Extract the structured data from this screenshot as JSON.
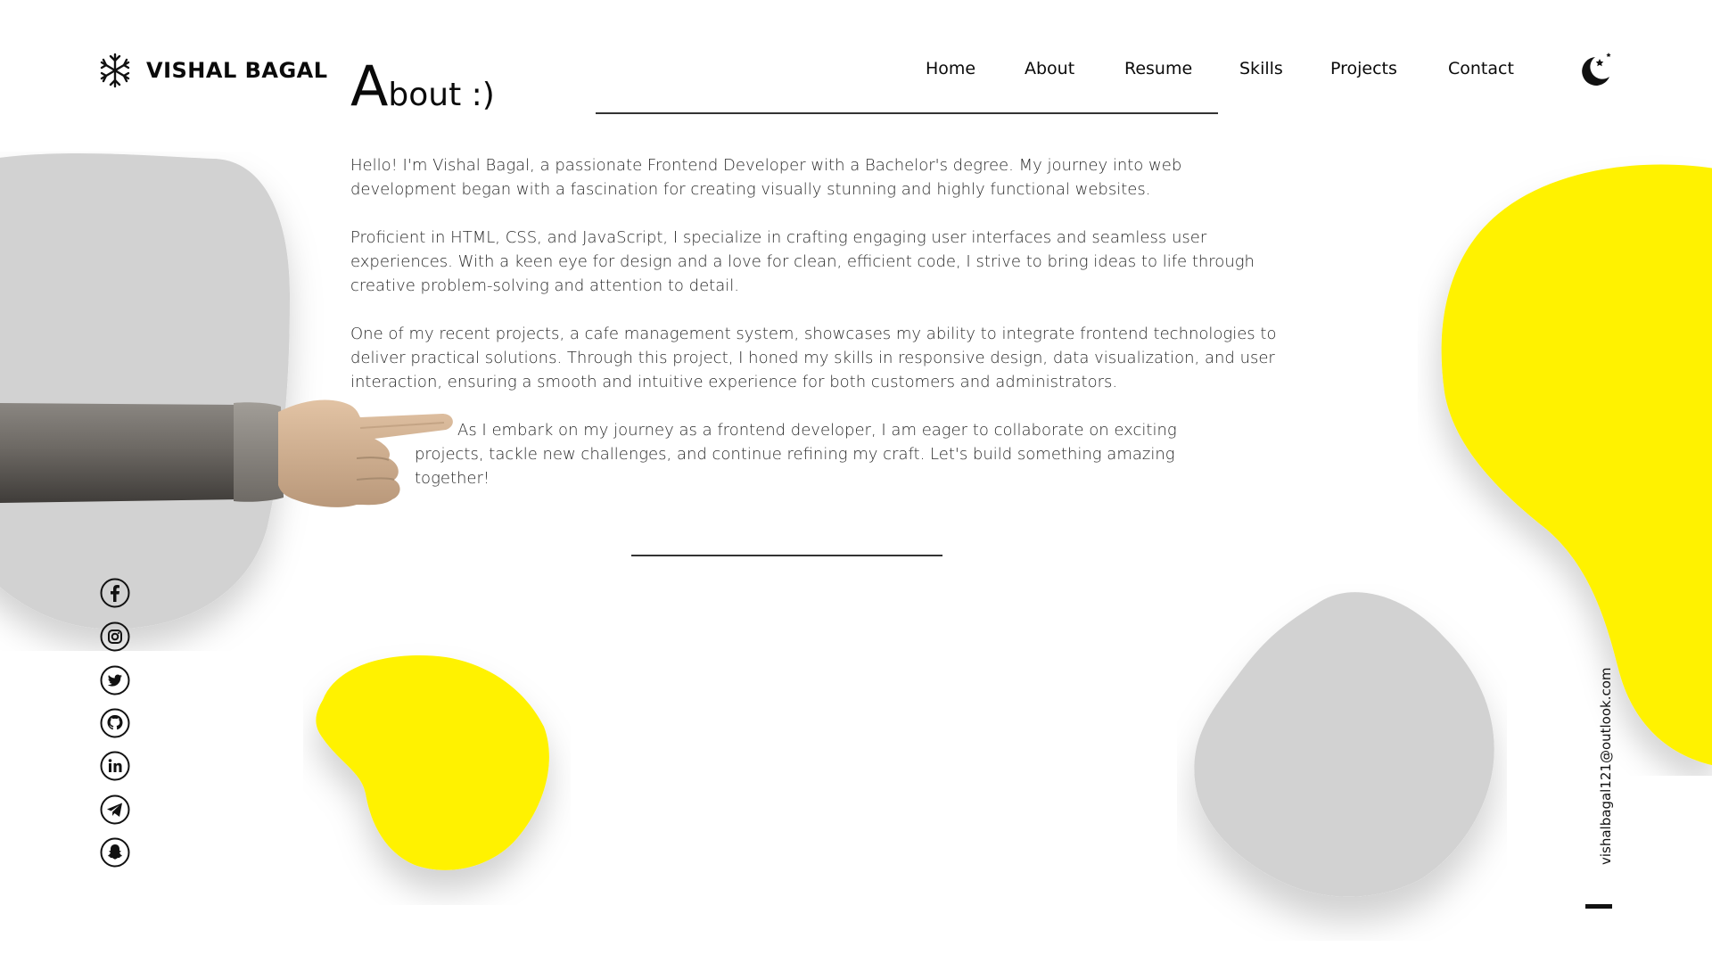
{
  "brand": {
    "name": "VISHAL BAGAL",
    "logo_icon": "snowflake-icon"
  },
  "nav": {
    "items": [
      {
        "label": "Home"
      },
      {
        "label": "About"
      },
      {
        "label": "Resume"
      },
      {
        "label": "Skills"
      },
      {
        "label": "Projects"
      },
      {
        "label": "Contact"
      }
    ],
    "theme_toggle_icon": "moon-stars-icon"
  },
  "about": {
    "title_initial": "A",
    "title_rest": "bout :)",
    "paragraphs": [
      "Hello! I'm Vishal Bagal, a passionate Frontend Developer with a Bachelor's degree. My journey into web development began with a fascination for creating visually stunning and highly functional websites.",
      "Proficient in HTML, CSS, and JavaScript, I specialize in crafting engaging user interfaces and seamless user experiences. With a keen eye for design and a love for clean, efficient code, I strive to bring ideas to life through creative problem-solving and attention to detail.",
      "One of my recent projects, a cafe management system, showcases my ability to integrate frontend technologies to deliver practical solutions. Through this project, I honed my skills in responsive design, data visualization, and user interaction, ensuring a smooth and intuitive experience for both customers and administrators.",
      "As I embark on my journey as a frontend developer, I am eager to collaborate on exciting projects, tackle new challenges, and continue refining my craft. Let's build something amazing together!"
    ]
  },
  "social": {
    "icons": [
      "facebook-icon",
      "instagram-icon",
      "twitter-icon",
      "github-icon",
      "linkedin-icon",
      "telegram-icon",
      "snapchat-icon"
    ]
  },
  "contact": {
    "email": "vishalbagal121@outlook.com"
  },
  "colors": {
    "accent_yellow": "#fff200",
    "blob_gray": "#d2d2d2",
    "text": "#111111"
  }
}
